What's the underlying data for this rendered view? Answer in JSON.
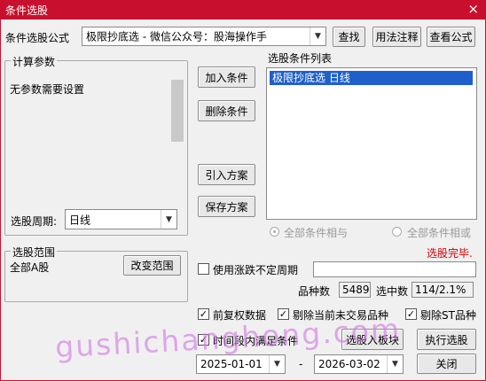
{
  "window": {
    "title": "条件选股",
    "close_glyph": "×"
  },
  "formula": {
    "label": "条件选股公式",
    "value": "极限抄底选  -  微信公众号：股海操作手",
    "find_button": "查找",
    "usage_button": "用法注释",
    "view_button": "查看公式"
  },
  "params": {
    "legend": "计算参数",
    "text": "无参数需要设置",
    "period_label": "选股周期:",
    "period_value": "日线"
  },
  "actions": {
    "add": "加入条件",
    "delete": "删除条件",
    "import": "引入方案",
    "save": "保存方案"
  },
  "conditions": {
    "label": "选股条件列表",
    "items": [
      "极限抄底选  日线"
    ],
    "radio_and": "全部条件相与",
    "radio_or": "全部条件相或",
    "status": "选股完毕."
  },
  "range": {
    "legend": "选股范围",
    "text": "全部A股",
    "change_button": "改变范围"
  },
  "options": {
    "use_period": "使用涨跌不定周期",
    "stock_count_label": "品种数",
    "stock_count_value": "5489",
    "selected_label": "选中数",
    "selected_value": "114/2.1%",
    "forward_adjust": "前复权数据",
    "exclude_untraded": "剔除当前未交易品种",
    "exclude_st": "剔除ST品种",
    "time_range": "时间段内满足条件",
    "check_glyph": "✓"
  },
  "dates": {
    "start": "2025-01-01",
    "separator": "-",
    "end": "2026-03-02"
  },
  "bottom": {
    "to_block": "选股入板块",
    "execute": "执行选股",
    "close": "关闭"
  },
  "icons": {
    "dropdown": "chevron-down-icon"
  },
  "watermark": "gushichanghong.com",
  "colors": {
    "title_bar": "#c8102e",
    "selection": "#1f5fcc",
    "status": "#d40000",
    "watermark": "#d278e6"
  }
}
